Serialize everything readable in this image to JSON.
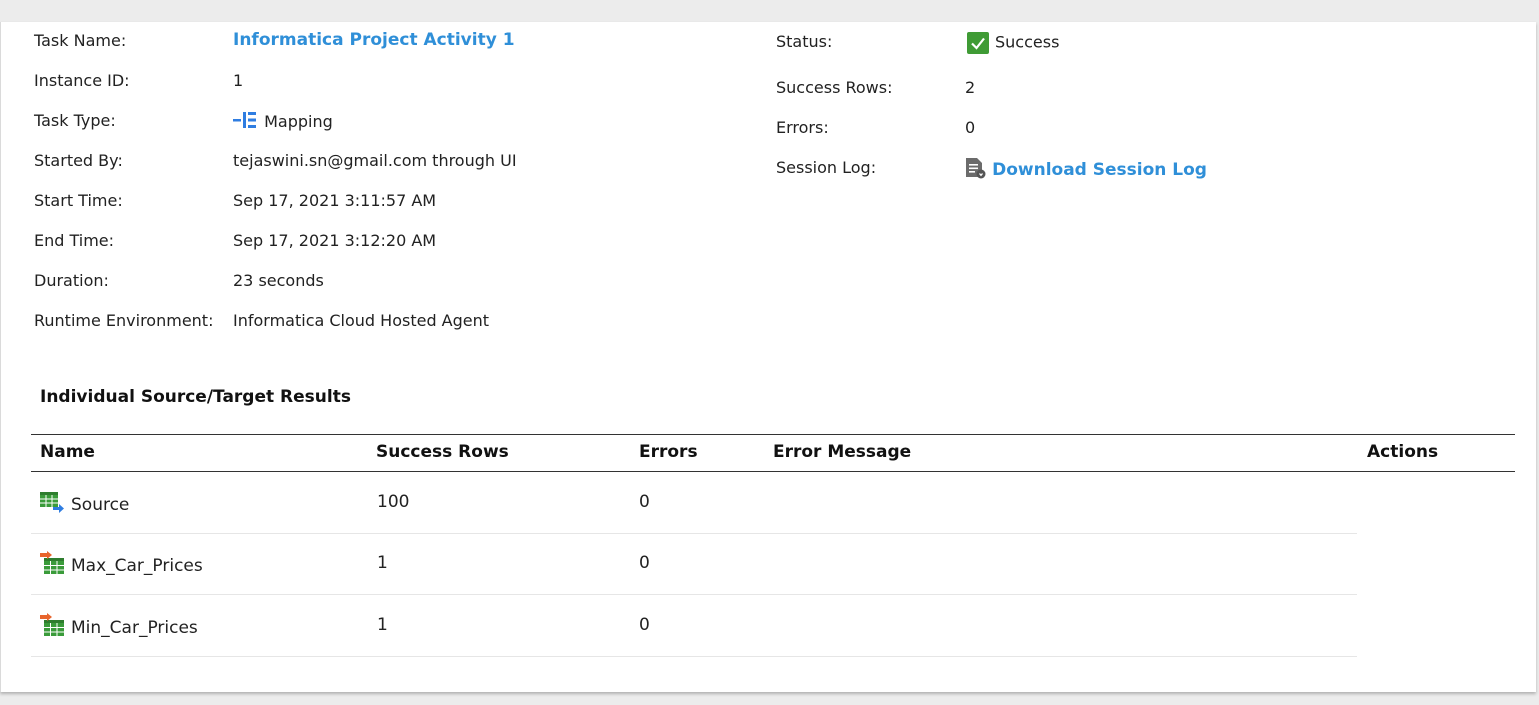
{
  "details_left": [
    {
      "label": "Task Name:",
      "value": "Informatica Project Activity 1",
      "kind": "link"
    },
    {
      "label": "Instance ID:",
      "value": "1",
      "kind": "text"
    },
    {
      "label": "Task Type:",
      "value": "Mapping",
      "kind": "icon-text",
      "icon": "mapping-icon"
    },
    {
      "label": "Started By:",
      "value": "tejaswini.sn@gmail.com through UI",
      "kind": "text"
    },
    {
      "label": "Start Time:",
      "value": "Sep 17, 2021 3:11:57 AM",
      "kind": "text"
    },
    {
      "label": "End Time:",
      "value": "Sep 17, 2021 3:12:20 AM",
      "kind": "text"
    },
    {
      "label": "Duration:",
      "value": "23 seconds",
      "kind": "text"
    },
    {
      "label": "Runtime Environment:",
      "value": "Informatica Cloud Hosted Agent",
      "kind": "text"
    }
  ],
  "details_right": [
    {
      "label": "Status:",
      "value": "Success",
      "kind": "status",
      "icon": "check-icon",
      "color": "#3f9b35"
    },
    {
      "label": "Success Rows:",
      "value": "2",
      "kind": "text"
    },
    {
      "label": "Errors:",
      "value": "0",
      "kind": "text"
    },
    {
      "label": "Session Log:",
      "value": "Download Session Log",
      "kind": "link",
      "icon": "session-log-icon"
    }
  ],
  "results": {
    "title": "Individual Source/Target Results",
    "headers": {
      "name": "Name",
      "success_rows": "Success Rows",
      "errors": "Errors",
      "error_message": "Error Message",
      "actions": "Actions"
    },
    "rows": [
      {
        "name": "Source",
        "success_rows": "100",
        "errors": "0",
        "error_message": "",
        "icon": "source-table-icon"
      },
      {
        "name": "Max_Car_Prices",
        "success_rows": "1",
        "errors": "0",
        "error_message": "",
        "icon": "target-table-icon"
      },
      {
        "name": "Min_Car_Prices",
        "success_rows": "1",
        "errors": "0",
        "error_message": "",
        "icon": "target-table-icon"
      }
    ]
  },
  "colors": {
    "link": "#2f8fd8",
    "success": "#3f9b35",
    "table_green": "#3a9b3a",
    "arrow_orange": "#e8642c",
    "arrow_blue": "#2f7de1"
  }
}
